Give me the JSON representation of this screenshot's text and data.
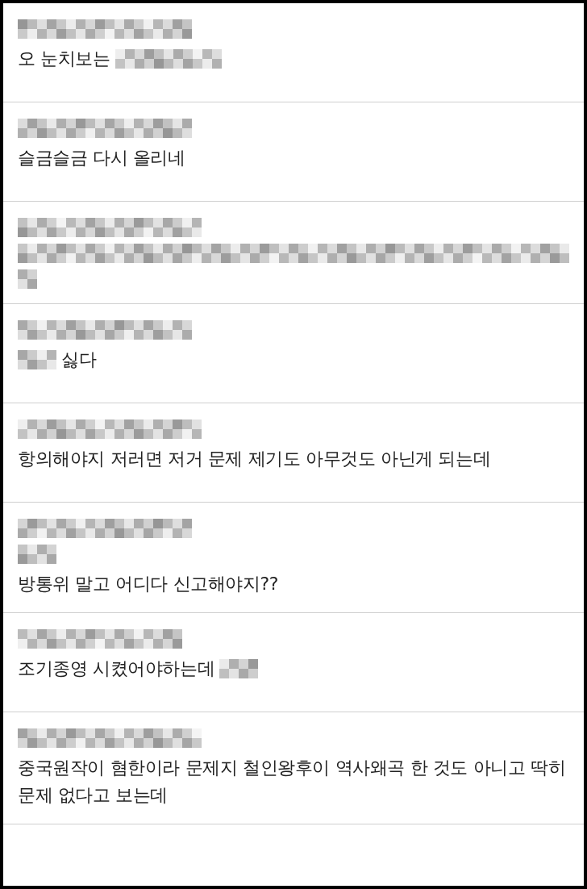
{
  "comments": [
    {
      "author": {
        "kind": "redacted"
      },
      "lines": [
        [
          {
            "kind": "text",
            "text": "오 눈치보는"
          },
          {
            "kind": "redacted"
          }
        ]
      ]
    },
    {
      "author": {
        "kind": "redacted"
      },
      "lines": [
        [
          {
            "kind": "text",
            "text": "슬금슬금 다시 올리네"
          }
        ]
      ]
    },
    {
      "author": {
        "kind": "redacted"
      },
      "lines": [
        [
          {
            "kind": "redacted"
          }
        ],
        [
          {
            "kind": "redacted"
          }
        ]
      ]
    },
    {
      "author": {
        "kind": "redacted"
      },
      "lines": [
        [
          {
            "kind": "redacted"
          },
          {
            "kind": "text",
            "text": "싫다"
          }
        ]
      ]
    },
    {
      "author": {
        "kind": "redacted"
      },
      "lines": [
        [
          {
            "kind": "text",
            "text": "항의해야지 저러면 저거 문제 제기도 아무것도 아닌게 되는데"
          }
        ]
      ]
    },
    {
      "author": {
        "kind": "redacted"
      },
      "lines": [
        [
          {
            "kind": "redacted"
          }
        ],
        [
          {
            "kind": "text",
            "text": "방통위 말고 어디다 신고해야지??"
          }
        ]
      ]
    },
    {
      "author": {
        "kind": "redacted"
      },
      "lines": [
        [
          {
            "kind": "text",
            "text": "조기종영 시켰어야하는데"
          },
          {
            "kind": "redacted"
          }
        ]
      ]
    },
    {
      "author": {
        "kind": "redacted"
      },
      "lines": [
        [
          {
            "kind": "text",
            "text": "중국원작이 혐한이라 문제지 철인왕후이 역사왜곡 한 것도 아니고 딱히 문제 없다고 보는데"
          }
        ]
      ]
    }
  ]
}
